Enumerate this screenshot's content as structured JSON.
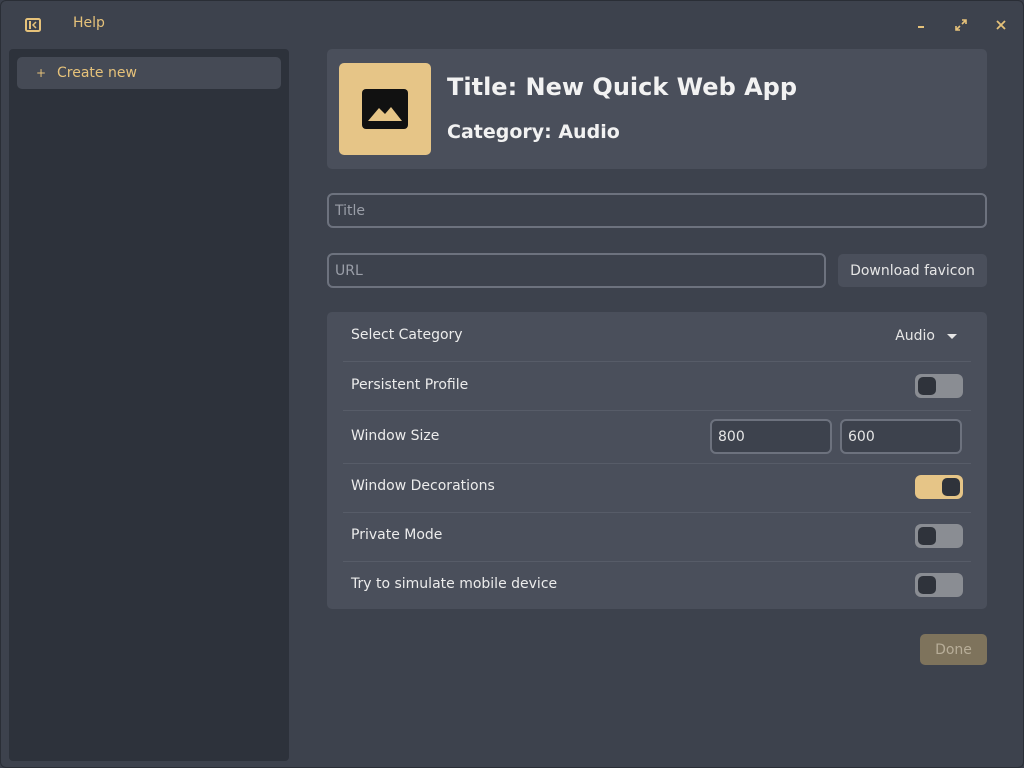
{
  "titlebar": {
    "help_label": "Help",
    "sidebar_toggle_icon": "sidebar-toggle-icon",
    "minimize_icon": "minimize-icon",
    "maximize_icon": "maximize-icon",
    "close_icon": "close-icon"
  },
  "sidebar": {
    "items": [
      {
        "icon": "plus-icon",
        "icon_glyph": "+",
        "label": "Create new"
      }
    ]
  },
  "header": {
    "icon": "image-icon",
    "title": "Title: New Quick Web App",
    "category": "Category: Audio"
  },
  "form": {
    "title_placeholder": "Title",
    "title_value": "",
    "url_placeholder": "URL",
    "url_value": "",
    "favicon_button": "Download favicon"
  },
  "settings": {
    "select_category": {
      "label": "Select Category",
      "value": "Audio"
    },
    "persistent_profile": {
      "label": "Persistent Profile",
      "enabled": false
    },
    "window_size": {
      "label": "Window Size",
      "width": "800",
      "height": "600"
    },
    "window_decorations": {
      "label": "Window Decorations",
      "enabled": true
    },
    "private_mode": {
      "label": "Private Mode",
      "enabled": false
    },
    "simulate_mobile": {
      "label": "Try to simulate mobile device",
      "enabled": false
    }
  },
  "done_button": "Done",
  "colors": {
    "accent": "#e6c587",
    "background": "#3d424d",
    "sidebar": "#2d323b",
    "card": "#4a4f5b"
  }
}
